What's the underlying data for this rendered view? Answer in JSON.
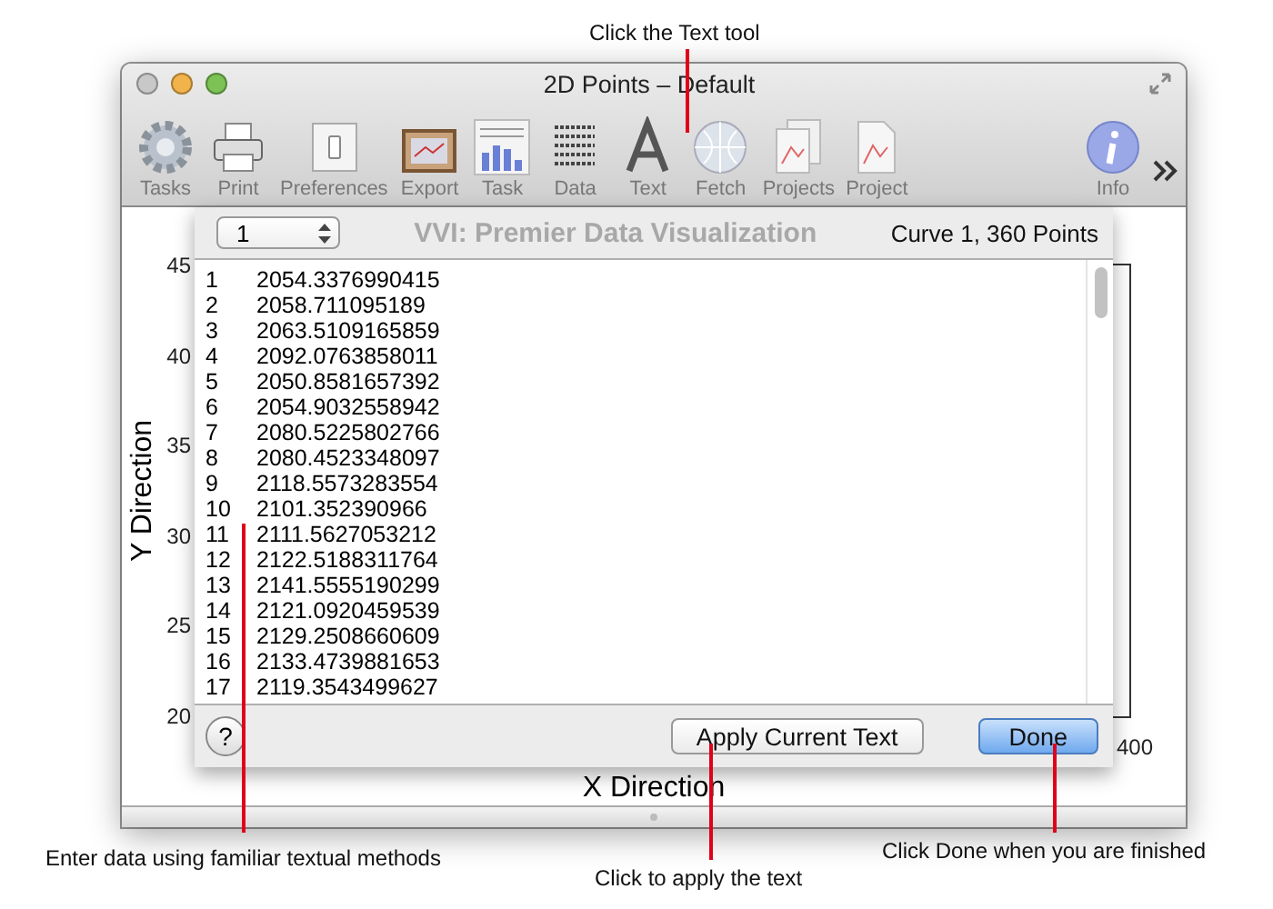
{
  "window": {
    "title": "2D Points – Default"
  },
  "toolbar": [
    {
      "label": "Tasks",
      "kind": "gear"
    },
    {
      "label": "Print",
      "kind": "printer"
    },
    {
      "label": "Preferences",
      "kind": "switch"
    },
    {
      "label": "Export",
      "kind": "picture"
    },
    {
      "label": "Task",
      "kind": "bars"
    },
    {
      "label": "Data",
      "kind": "numbers"
    },
    {
      "label": "Text",
      "kind": "letter"
    },
    {
      "label": "Fetch",
      "kind": "globe"
    },
    {
      "label": "Projects",
      "kind": "documents"
    },
    {
      "label": "Project",
      "kind": "document"
    },
    {
      "label": "Info",
      "kind": "info"
    }
  ],
  "plot": {
    "title": "VVI: Premier Data Visualization",
    "ylabel": "Y Direction",
    "xlabel": "X Direction",
    "yticks": [
      "45",
      "40",
      "35",
      "30",
      "25",
      "20"
    ],
    "xticks": [
      "400"
    ]
  },
  "sheet": {
    "curve_select": "1",
    "curve_info": "Curve 1, 360 Points",
    "rows": [
      {
        "index": "1",
        "value": "2054.3376990415"
      },
      {
        "index": "2",
        "value": "2058.711095189"
      },
      {
        "index": "3",
        "value": "2063.5109165859"
      },
      {
        "index": "4",
        "value": "2092.0763858011"
      },
      {
        "index": "5",
        "value": "2050.8581657392"
      },
      {
        "index": "6",
        "value": "2054.9032558942"
      },
      {
        "index": "7",
        "value": "2080.5225802766"
      },
      {
        "index": "8",
        "value": "2080.4523348097"
      },
      {
        "index": "9",
        "value": "2118.5573283554"
      },
      {
        "index": "10",
        "value": "2101.352390966"
      },
      {
        "index": "11",
        "value": "2111.5627053212"
      },
      {
        "index": "12",
        "value": "2122.5188311764"
      },
      {
        "index": "13",
        "value": "2141.5555190299"
      },
      {
        "index": "14",
        "value": "2121.0920459539"
      },
      {
        "index": "15",
        "value": "2129.2508660609"
      },
      {
        "index": "16",
        "value": "2133.4739881653"
      },
      {
        "index": "17",
        "value": "2119.3543499627"
      }
    ],
    "help": "?",
    "buttons": [
      {
        "label": "Apply Current Text",
        "kind": "plain"
      },
      {
        "label": "Done",
        "kind": "default"
      }
    ]
  },
  "callouts": [
    {
      "text": "Click the Text tool",
      "kind": "top"
    },
    {
      "text": "Enter data using familiar textual methods",
      "kind": "text-area"
    },
    {
      "text": "Click to apply the text",
      "kind": "apply"
    },
    {
      "text": "Click Done when you are finished",
      "kind": "done"
    }
  ]
}
